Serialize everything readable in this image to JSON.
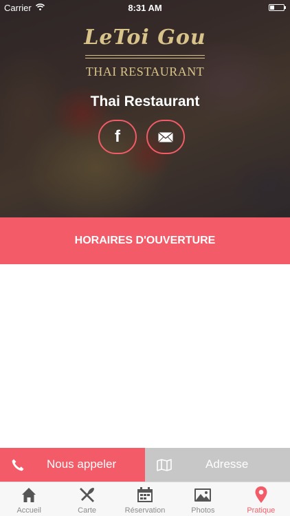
{
  "status_bar": {
    "carrier": "Carrier",
    "time": "8:31 AM"
  },
  "header": {
    "logo_script": "LeToi Gou",
    "logo_sub": "THAI RESTAURANT",
    "title": "Thai Restaurant",
    "facebook_glyph": "f"
  },
  "section": {
    "title": "HORAIRES D'OUVERTURE"
  },
  "actions": {
    "call_label": "Nous appeler",
    "address_label": "Adresse"
  },
  "tabs": [
    {
      "label": "Accueil",
      "icon": "home-icon"
    },
    {
      "label": "Carte",
      "icon": "utensils-icon"
    },
    {
      "label": "Réservation",
      "icon": "calendar-icon"
    },
    {
      "label": "Photos",
      "icon": "photos-icon"
    },
    {
      "label": "Pratique",
      "icon": "location-pin-icon",
      "active": true
    }
  ],
  "colors": {
    "accent": "#f25b67",
    "secondary_button": "#c7c7c7",
    "logo_gold": "#d8c48a"
  }
}
